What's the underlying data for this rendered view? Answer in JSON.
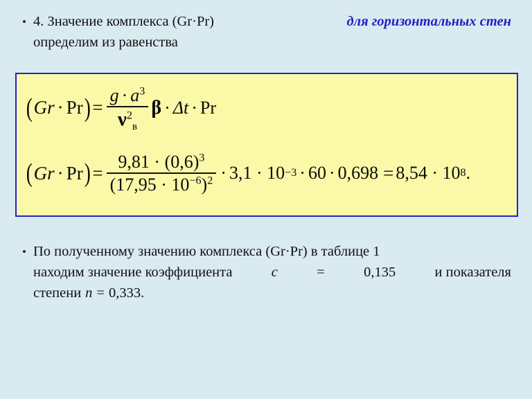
{
  "slide": {
    "background_color": "#daeaf1",
    "accent_blue": "#2222cc",
    "box_fill": "#fbf8a8"
  },
  "paragraph_1": {
    "bullet": "•",
    "line1_plain": "4.  Значение  комплекса  (Gr·Pr)",
    "line1_emphasis": "для  горизонтальных  стен",
    "line2": "определим из равенства",
    "full_text": "4. Значение комплекса (Gr·Pr) для горизонтальных стен определим из равенства"
  },
  "formula_box": {
    "formula_1": {
      "lhs_open": "(",
      "lhs_gr": "Gr",
      "lhs_dot": "·",
      "lhs_pr": "Pr",
      "lhs_close": ")",
      "equals": "=",
      "numerator_g": "g",
      "numerator_dot": "·",
      "numerator_a": "a",
      "numerator_a_exp": "3",
      "denominator_nu": "ν",
      "denominator_exp": "2",
      "denominator_sub": "в",
      "beta": "β",
      "mul1": "·",
      "delta_t": "Δt",
      "mul2": "·",
      "pr": "Pr",
      "plain": "(Gr·Pr) = g·a³ / ν²в · β · Δt · Pr"
    },
    "formula_2": {
      "lhs_open": "(",
      "lhs_gr": "Gr",
      "lhs_dot": "·",
      "lhs_pr": "Pr",
      "lhs_close": ")",
      "equals": "=",
      "numerator": "9,81 · (0,6)",
      "numerator_exp": "3",
      "denominator": "(17,95 · 10",
      "denominator_inner_exp": "−6",
      "denominator_close": ")",
      "denominator_exp": "2",
      "tail_mul": "·",
      "tail_factor1": "3,1 · 10",
      "tail_factor1_exp": "−3",
      "tail_mul2": "·",
      "tail_factor2": "60",
      "tail_mul3": "·",
      "tail_factor3": "0,698",
      "tail_equals": "=",
      "result": "8,54 · 10",
      "result_exp": "8",
      "result_period": ".",
      "plain": "(Gr·Pr) = 9,81·(0,6)³ / (17,95·10⁻⁶)² · 3,1·10⁻³ · 60 · 0,698 = 8,54·10⁸."
    }
  },
  "paragraph_2": {
    "bullet": "•",
    "line1": "По  полученному  значению  комплекса  (Gr·Pr)  в  таблице  1",
    "line2_a": "находим  значение  коэффициента",
    "line2_var": "c",
    "line2_eq": "=",
    "line2_val": "0,135",
    "line2_b": "и  показателя",
    "line3_a": "степени",
    "line3_var": "n",
    "line3_eq": "=",
    "line3_val": "0,333.",
    "full_text": "По полученному значению комплекса (Gr·Pr) в таблице 1 находим значение коэффициента c = 0,135 и показателя степени n = 0,333."
  }
}
